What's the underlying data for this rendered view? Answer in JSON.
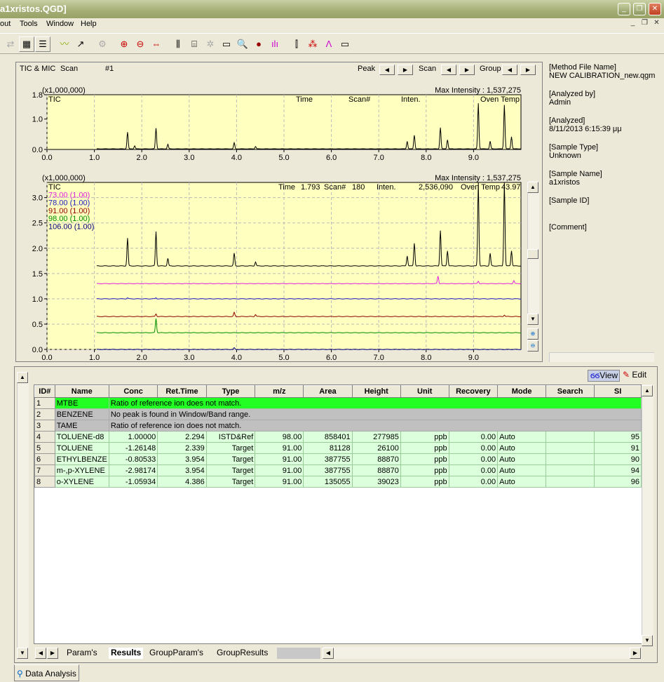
{
  "window": {
    "title": "a1xristos.QGD]"
  },
  "menu": [
    "out",
    "Tools",
    "Window",
    "Help"
  ],
  "chart_header": {
    "mode": "TIC & MIC",
    "scan_label": "Scan",
    "scan_value": "#1",
    "peak": "Peak",
    "scan": "Scan",
    "group": "Group"
  },
  "chart_data": [
    {
      "type": "line",
      "title": "",
      "multiplier": "(x1,000,000)",
      "max_intensity": "Max Intensity : 1,537,275",
      "trace_label": "TIC",
      "readout": {
        "time_label": "Time",
        "time": "",
        "scan_label": "Scan#",
        "scan": "",
        "inten_label": "Inten.",
        "inten": "",
        "oven_label": "Oven Temp",
        "oven": ""
      },
      "xlim": [
        0,
        10
      ],
      "ylim": [
        0,
        1.8
      ],
      "xticks": [
        "0.0",
        "1.0",
        "2.0",
        "3.0",
        "4.0",
        "5.0",
        "6.0",
        "7.0",
        "8.0",
        "9.0"
      ],
      "yticks": [
        "0.0",
        "1.0",
        "1.8"
      ],
      "series": [
        {
          "color": "#000000",
          "baseline": 0.02,
          "peaks": [
            [
              1.7,
              0.55
            ],
            [
              1.85,
              0.1
            ],
            [
              2.3,
              0.68
            ],
            [
              2.55,
              0.15
            ],
            [
              3.95,
              0.2
            ],
            [
              4.4,
              0.08
            ],
            [
              7.6,
              0.25
            ],
            [
              7.75,
              0.45
            ],
            [
              8.3,
              0.7
            ],
            [
              8.45,
              0.3
            ],
            [
              9.1,
              1.5
            ],
            [
              9.35,
              0.25
            ],
            [
              9.65,
              1.45
            ],
            [
              9.8,
              0.4
            ]
          ]
        }
      ]
    },
    {
      "type": "line",
      "title": "",
      "multiplier": "(x1,000,000)",
      "max_intensity": "Max Intensity : 1,537,275",
      "trace_label": "TIC",
      "readout": {
        "time_label": "Time",
        "time": "1.793",
        "scan_label": "Scan#",
        "scan": "180",
        "inten_label": "Inten.",
        "inten": "2,536,090",
        "oven_label": "Oven Temp",
        "oven": "43.97"
      },
      "xlim": [
        0,
        10
      ],
      "ylim": [
        0,
        3.3
      ],
      "xticks": [
        "0.0",
        "1.0",
        "2.0",
        "3.0",
        "4.0",
        "5.0",
        "6.0",
        "7.0",
        "8.0",
        "9.0"
      ],
      "yticks": [
        "0.0",
        "0.5",
        "1.0",
        "1.5",
        "2.0",
        "2.5",
        "3.0"
      ],
      "series": [
        {
          "name": "TIC",
          "color": "#000000",
          "baseline": 1.65,
          "peaks": [
            [
              1.7,
              0.55
            ],
            [
              2.3,
              0.68
            ],
            [
              2.55,
              0.15
            ],
            [
              3.95,
              0.25
            ],
            [
              4.4,
              0.08
            ],
            [
              7.6,
              0.2
            ],
            [
              7.75,
              0.45
            ],
            [
              8.3,
              0.7
            ],
            [
              8.45,
              0.3
            ],
            [
              9.1,
              1.65
            ],
            [
              9.35,
              0.25
            ],
            [
              9.65,
              1.65
            ],
            [
              9.8,
              0.3
            ]
          ]
        },
        {
          "name": "73.00 (1.00)",
          "color": "#e020e0",
          "baseline": 1.3,
          "peaks": [
            [
              8.25,
              0.15
            ],
            [
              9.1,
              0.05
            ],
            [
              9.85,
              0.06
            ]
          ]
        },
        {
          "name": "78.00 (1.00)",
          "color": "#2020c0",
          "baseline": 1.0,
          "peaks": [
            [
              1.7,
              0.02
            ],
            [
              2.3,
              0.02
            ]
          ]
        },
        {
          "name": "91.00 (1.00)",
          "color": "#900000",
          "baseline": 0.65,
          "peaks": [
            [
              2.3,
              0.05
            ],
            [
              3.95,
              0.08
            ],
            [
              4.4,
              0.04
            ],
            [
              9.65,
              0.03
            ]
          ]
        },
        {
          "name": "98.00 (1.00)",
          "color": "#009000",
          "baseline": 0.33,
          "peaks": [
            [
              2.3,
              0.28
            ]
          ]
        },
        {
          "name": "106.00 (1.00)",
          "color": "#000080",
          "baseline": 0.0,
          "peaks": [
            [
              3.95,
              0.03
            ]
          ]
        }
      ]
    }
  ],
  "info": [
    [
      "[Method File Name]",
      "NEW CALIBRATION_new.qgm"
    ],
    [
      "[Analyzed by]",
      "Admin"
    ],
    [
      "[Analyzed]",
      "8/11/2013 6:15:39 μμ"
    ],
    [
      "[Sample Type]",
      "Unknown"
    ],
    [
      "[Sample Name]",
      "a1xristos"
    ],
    [
      "[Sample ID]",
      ""
    ],
    [
      "[Comment]",
      ""
    ]
  ],
  "view_label": "View",
  "edit_label": "Edit",
  "table": {
    "headers": [
      "ID#",
      "Name",
      "Conc",
      "Ret.Time",
      "Type",
      "m/z",
      "Area",
      "Height",
      "Unit",
      "Recovery",
      "Mode",
      "Search",
      "SI"
    ],
    "msg_rows": [
      [
        "1",
        "MTBE",
        "Ratio of reference ion does not match."
      ],
      [
        "2",
        "BENZENE",
        "No peak is found in Window/Band range."
      ],
      [
        "3",
        "TAME",
        "Ratio of reference ion does not match."
      ]
    ],
    "rows": [
      [
        "4",
        "TOLUENE-d8",
        "1.00000",
        "2.294",
        "ISTD&Ref",
        "98.00",
        "858401",
        "277985",
        "ppb",
        "0.00",
        "Auto",
        "",
        "95"
      ],
      [
        "5",
        "TOLUENE",
        "-1.26148",
        "2.339",
        "Target",
        "91.00",
        "81128",
        "26100",
        "ppb",
        "0.00",
        "Auto",
        "",
        "91"
      ],
      [
        "6",
        "ETHYLBENZE",
        "-0.80533",
        "3.954",
        "Target",
        "91.00",
        "387755",
        "88870",
        "ppb",
        "0.00",
        "Auto",
        "",
        "90"
      ],
      [
        "7",
        "m-,p-XYLENE",
        "-2.98174",
        "3.954",
        "Target",
        "91.00",
        "387755",
        "88870",
        "ppb",
        "0.00",
        "Auto",
        "",
        "94"
      ],
      [
        "8",
        "o-XYLENE",
        "-1.05934",
        "4.386",
        "Target",
        "91.00",
        "135055",
        "39023",
        "ppb",
        "0.00",
        "Auto",
        "",
        "96"
      ]
    ]
  },
  "sheet_tabs": [
    "Param's",
    "Results",
    "GroupParam's",
    "GroupResults"
  ],
  "bottom_tab": "Data Analysis"
}
